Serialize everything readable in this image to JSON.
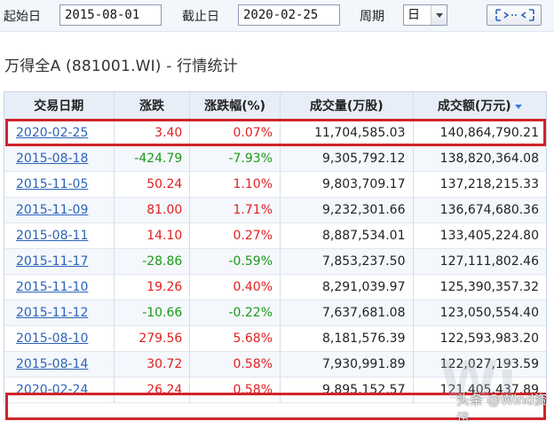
{
  "toolbar": {
    "start_label": "起始日",
    "start_value": "2015-08-01",
    "end_label": "截止日",
    "end_value": "2020-02-25",
    "period_label": "周期",
    "period_value": "日"
  },
  "title": "万得全A (881001.WI) - 行情统计",
  "table": {
    "columns": [
      "交易日期",
      "涨跌",
      "涨跌幅(%)",
      "成交量(万股)",
      "成交额(万元)"
    ],
    "sort_column": "成交额(万元)",
    "rows": [
      {
        "date": "2020-02-25",
        "change": "3.40",
        "pct": "0.07%",
        "volume": "11,704,585.03",
        "amount": "140,864,790.21",
        "dir": "up"
      },
      {
        "date": "2015-08-18",
        "change": "-424.79",
        "pct": "-7.93%",
        "volume": "9,305,792.12",
        "amount": "138,820,364.08",
        "dir": "down"
      },
      {
        "date": "2015-11-05",
        "change": "50.24",
        "pct": "1.10%",
        "volume": "9,803,709.17",
        "amount": "137,218,215.33",
        "dir": "up"
      },
      {
        "date": "2015-11-09",
        "change": "81.00",
        "pct": "1.71%",
        "volume": "9,232,301.66",
        "amount": "136,674,680.36",
        "dir": "up"
      },
      {
        "date": "2015-08-11",
        "change": "14.10",
        "pct": "0.27%",
        "volume": "8,887,534.01",
        "amount": "133,405,224.80",
        "dir": "up"
      },
      {
        "date": "2015-11-17",
        "change": "-28.86",
        "pct": "-0.59%",
        "volume": "7,853,237.50",
        "amount": "127,111,802.46",
        "dir": "down"
      },
      {
        "date": "2015-11-10",
        "change": "19.26",
        "pct": "0.40%",
        "volume": "8,291,039.97",
        "amount": "125,390,357.32",
        "dir": "up"
      },
      {
        "date": "2015-11-12",
        "change": "-10.66",
        "pct": "-0.22%",
        "volume": "7,637,681.08",
        "amount": "123,050,554.40",
        "dir": "down"
      },
      {
        "date": "2015-08-10",
        "change": "279.56",
        "pct": "5.68%",
        "volume": "8,181,576.39",
        "amount": "122,593,983.20",
        "dir": "up"
      },
      {
        "date": "2015-08-14",
        "change": "30.72",
        "pct": "0.58%",
        "volume": "7,930,991.89",
        "amount": "122,027,193.59",
        "dir": "up"
      },
      {
        "date": "2020-02-24",
        "change": "26.24",
        "pct": "0.58%",
        "volume": "9,895,152.57",
        "amount": "121,405,437.89",
        "dir": "up"
      }
    ]
  },
  "watermark": {
    "big": "Wi",
    "text": "头条 @Wind资讯"
  },
  "colors": {
    "up": "#e02020",
    "down": "#1a9a1a",
    "link": "#2c63b8",
    "highlight": "#d0232a",
    "header_bg": "#e7eef7"
  }
}
